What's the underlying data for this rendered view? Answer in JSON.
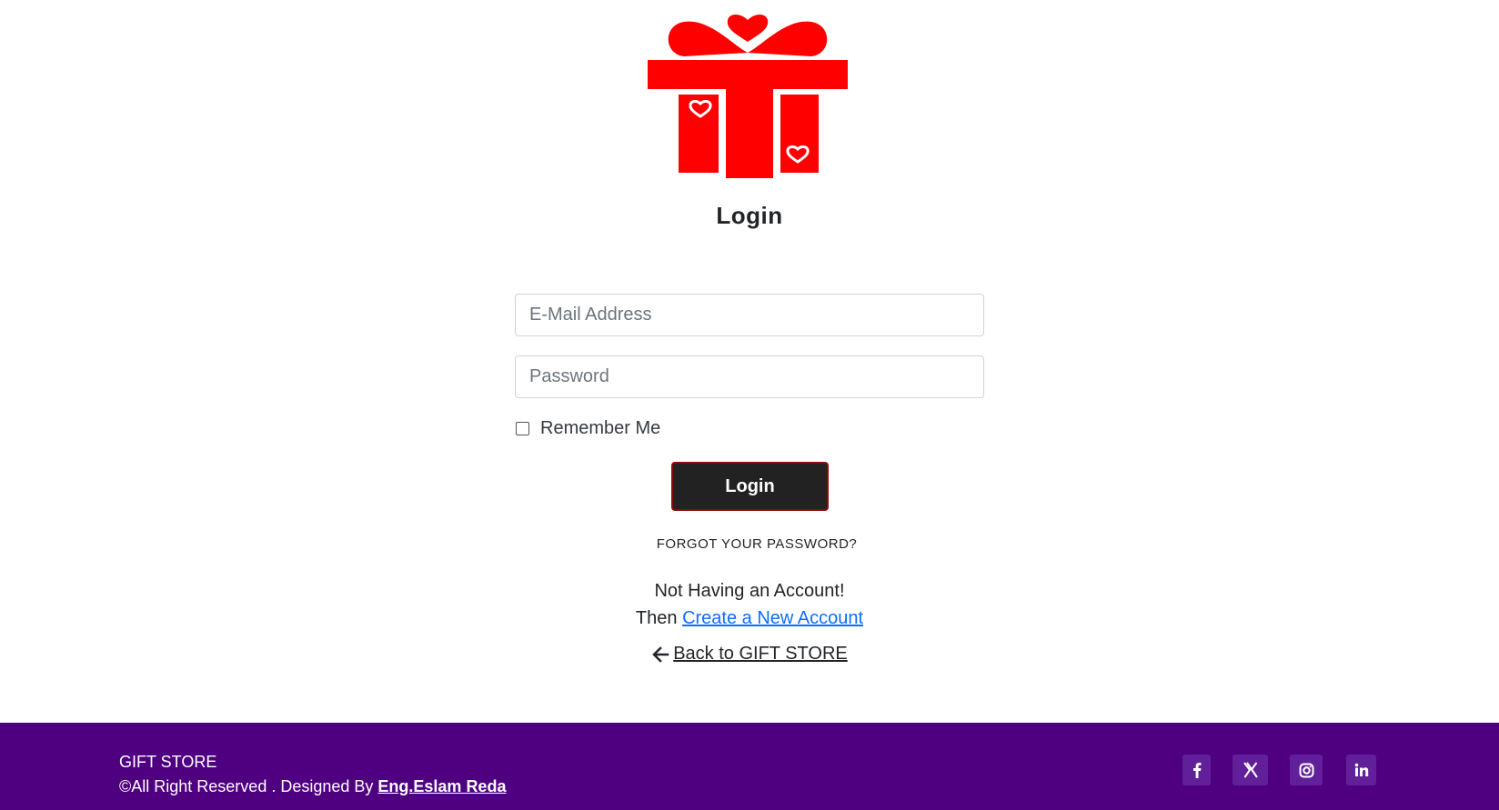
{
  "login": {
    "title": "Login",
    "email_placeholder": "E-Mail Address",
    "password_placeholder": "Password",
    "remember_label": "Remember Me",
    "button_label": "Login",
    "forgot_label": "FORGOT YOUR PASSWORD?",
    "no_account_text": "Not Having an Account!",
    "then_text": "Then",
    "create_account_label": "Create a New Account",
    "back_label": "Back to GIFT STORE",
    "remember_checked": false
  },
  "footer": {
    "brand": "GIFT STORE",
    "copyright_text": "©All Right Reserved . Designed By",
    "designer": "Eng.Eslam Reda",
    "social": [
      "facebook-icon",
      "x-icon",
      "instagram-icon",
      "linkedin-icon"
    ]
  },
  "colors": {
    "logo": "#ff0000",
    "footer_bg": "#4e0080",
    "social_bg": "#61209a",
    "link": "#0d6efd",
    "button_bg": "#222222",
    "button_border": "#8b0a0a"
  },
  "icons": {
    "logo": "gift-box-hearts-icon",
    "back": "arrow-left-icon"
  }
}
